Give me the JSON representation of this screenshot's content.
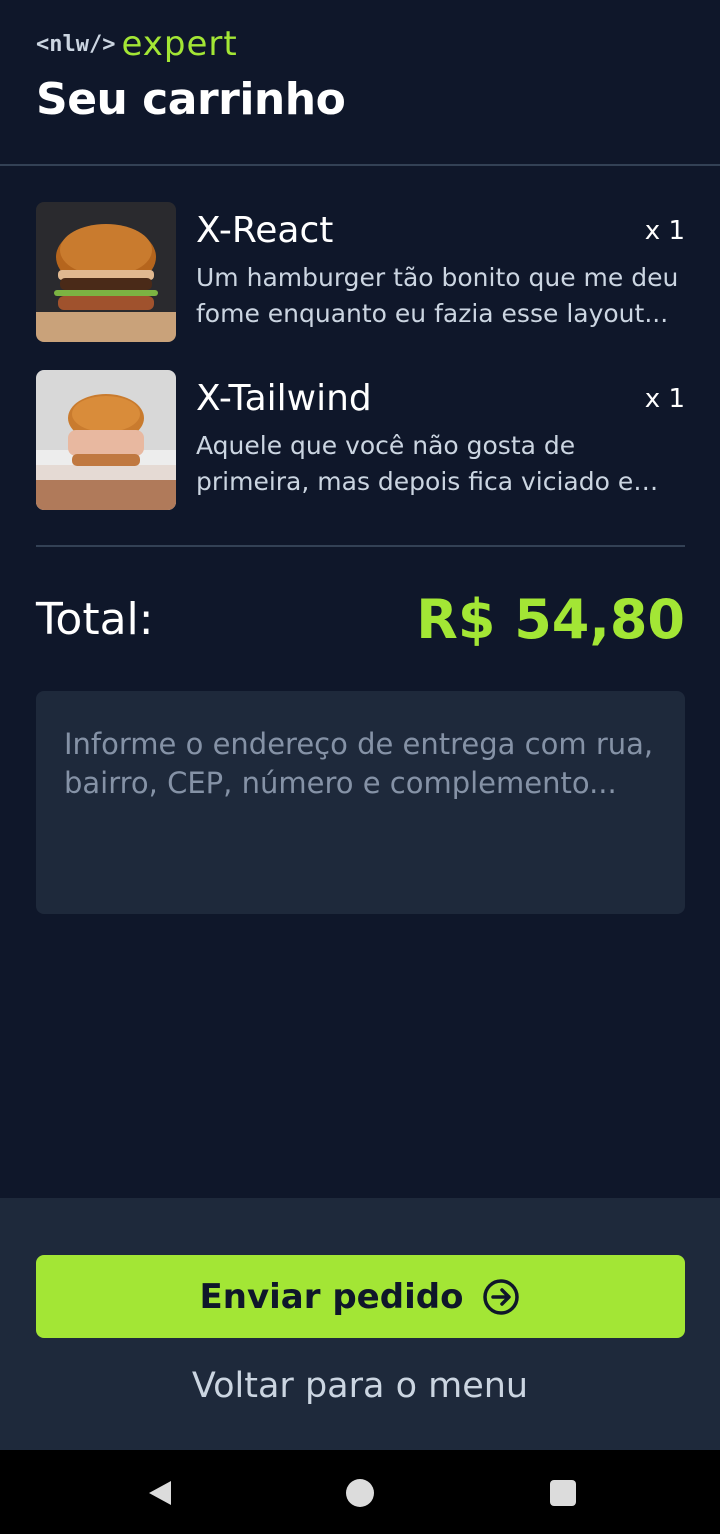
{
  "header": {
    "logo_prefix": "<nlw/>",
    "logo_suffix": "expert",
    "title": "Seu carrinho"
  },
  "cart": {
    "items": [
      {
        "title": "X-React",
        "quantity": "x 1",
        "description": "Um hamburger tão bonito que me deu fome enquanto eu fazia esse layout...",
        "image": "burger-icon"
      },
      {
        "title": "X-Tailwind",
        "quantity": "x 1",
        "description": "Aquele que você não gosta de primeira, mas depois fica viciado e não consegue parar...",
        "image": "burger-icon"
      }
    ]
  },
  "total": {
    "label": "Total:",
    "value": "R$ 54,80"
  },
  "address": {
    "placeholder": "Informe o endereço de entrega com rua, bairro, CEP, número e complemento..."
  },
  "footer": {
    "send_label": "Enviar pedido",
    "send_icon": "arrow-circle-right-icon",
    "back_label": "Voltar para o menu"
  },
  "system_nav": {
    "back": "back-triangle-icon",
    "home": "home-circle-icon",
    "recent": "recent-square-icon"
  },
  "colors": {
    "background": "#0f172a",
    "surface": "#1e293b",
    "accent": "#a3e635",
    "divider": "#334155"
  }
}
